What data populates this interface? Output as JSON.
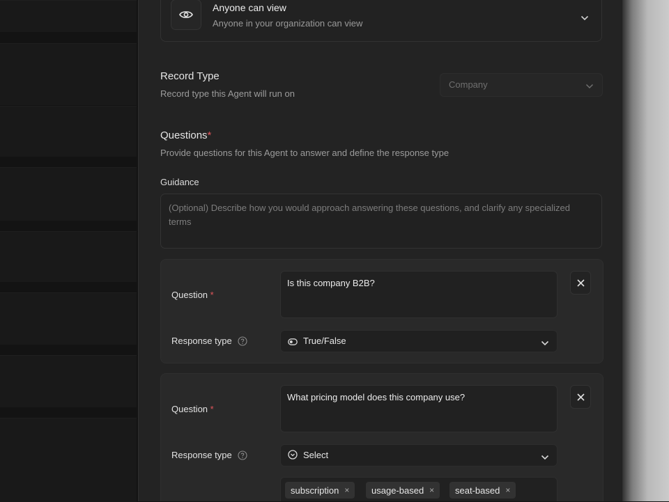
{
  "visibility": {
    "title": "Anyone can view",
    "subtitle": "Anyone in your organization can view"
  },
  "record_type": {
    "title": "Record Type",
    "subtitle": "Record type this Agent will run on",
    "selected": "Company"
  },
  "questions": {
    "title": "Questions",
    "required_marker": "*",
    "subtitle": "Provide questions for this Agent to answer and define the response type",
    "guidance_label": "Guidance",
    "guidance_placeholder": "(Optional) Describe how you would approach answering these questions, and clarify any specialized terms",
    "items": [
      {
        "question_label": "Question",
        "required_marker": "*",
        "question_text": "Is this company B2B?",
        "response_label": "Response type",
        "response_value": "True/False",
        "response_icon": "toggle-icon"
      },
      {
        "question_label": "Question",
        "required_marker": "*",
        "question_text": "What pricing model does this company use?",
        "response_label": "Response type",
        "response_value": "Select",
        "response_icon": "chevron-circle-icon",
        "options": [
          {
            "label": "subscription",
            "remove": "×"
          },
          {
            "label": "usage-based",
            "remove": "×"
          },
          {
            "label": "seat-based",
            "remove": "×"
          }
        ]
      }
    ]
  },
  "colors": {
    "panel_bg": "#232323",
    "card_bg": "#292929",
    "required_red": "#e0565b"
  }
}
